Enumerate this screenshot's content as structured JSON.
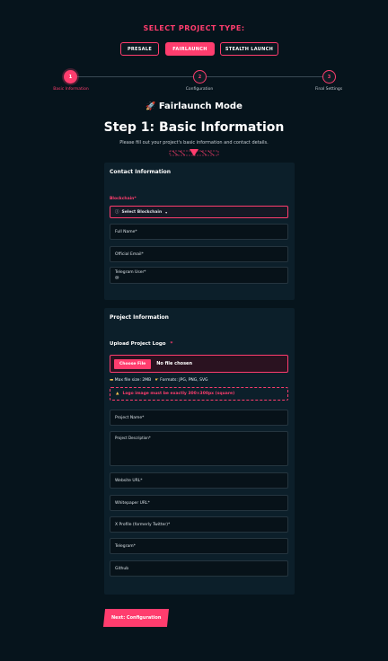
{
  "project_type": {
    "title": "SELECT PROJECT TYPE:",
    "options": [
      "PRESALE",
      "FAIRLAUNCH",
      "STEALTH LAUNCH"
    ],
    "selected": "FAIRLAUNCH"
  },
  "steps": [
    {
      "number": "1",
      "label": "Basic Information",
      "active": true
    },
    {
      "number": "2",
      "label": "Configuration",
      "active": false
    },
    {
      "number": "3",
      "label": "Final Settings",
      "active": false
    }
  ],
  "mode": {
    "icon": "rocket-icon",
    "title": "Fairlaunch Mode"
  },
  "header": {
    "step_title": "Step 1: Basic Information",
    "description": "Please fill out your project's basic information and contact details."
  },
  "contact": {
    "title": "Contact Information",
    "blockchain_label": "Blockchain*",
    "blockchain_value": "Select Blockchain",
    "full_name": "Full Name*",
    "official_email": "Official Email*",
    "telegram_user": "Telegram User*"
  },
  "project": {
    "title": "Project Information",
    "upload_label": "Upload Project Logo",
    "required_mark": "*",
    "choose_file": "Choose File",
    "no_file": "No file chosen",
    "max_size": "Max file size: 2MB",
    "formats": "Formats: JPG, PNG, SVG",
    "warning": "Logo image must be exactly 300×300px (square)",
    "project_name": "Project Name*",
    "project_description": "Project Description*",
    "website_url": "Website URL*",
    "whitepaper_url": "Whitepaper URL*",
    "x_profile": "X Profile (formerly Twitter)*",
    "telegram": "Telegram*",
    "github": "Github"
  },
  "actions": {
    "next": "Next: Configuration"
  },
  "colors": {
    "accent": "#ff3d6e",
    "background": "#06141c",
    "panel": "#0c1f2a"
  }
}
